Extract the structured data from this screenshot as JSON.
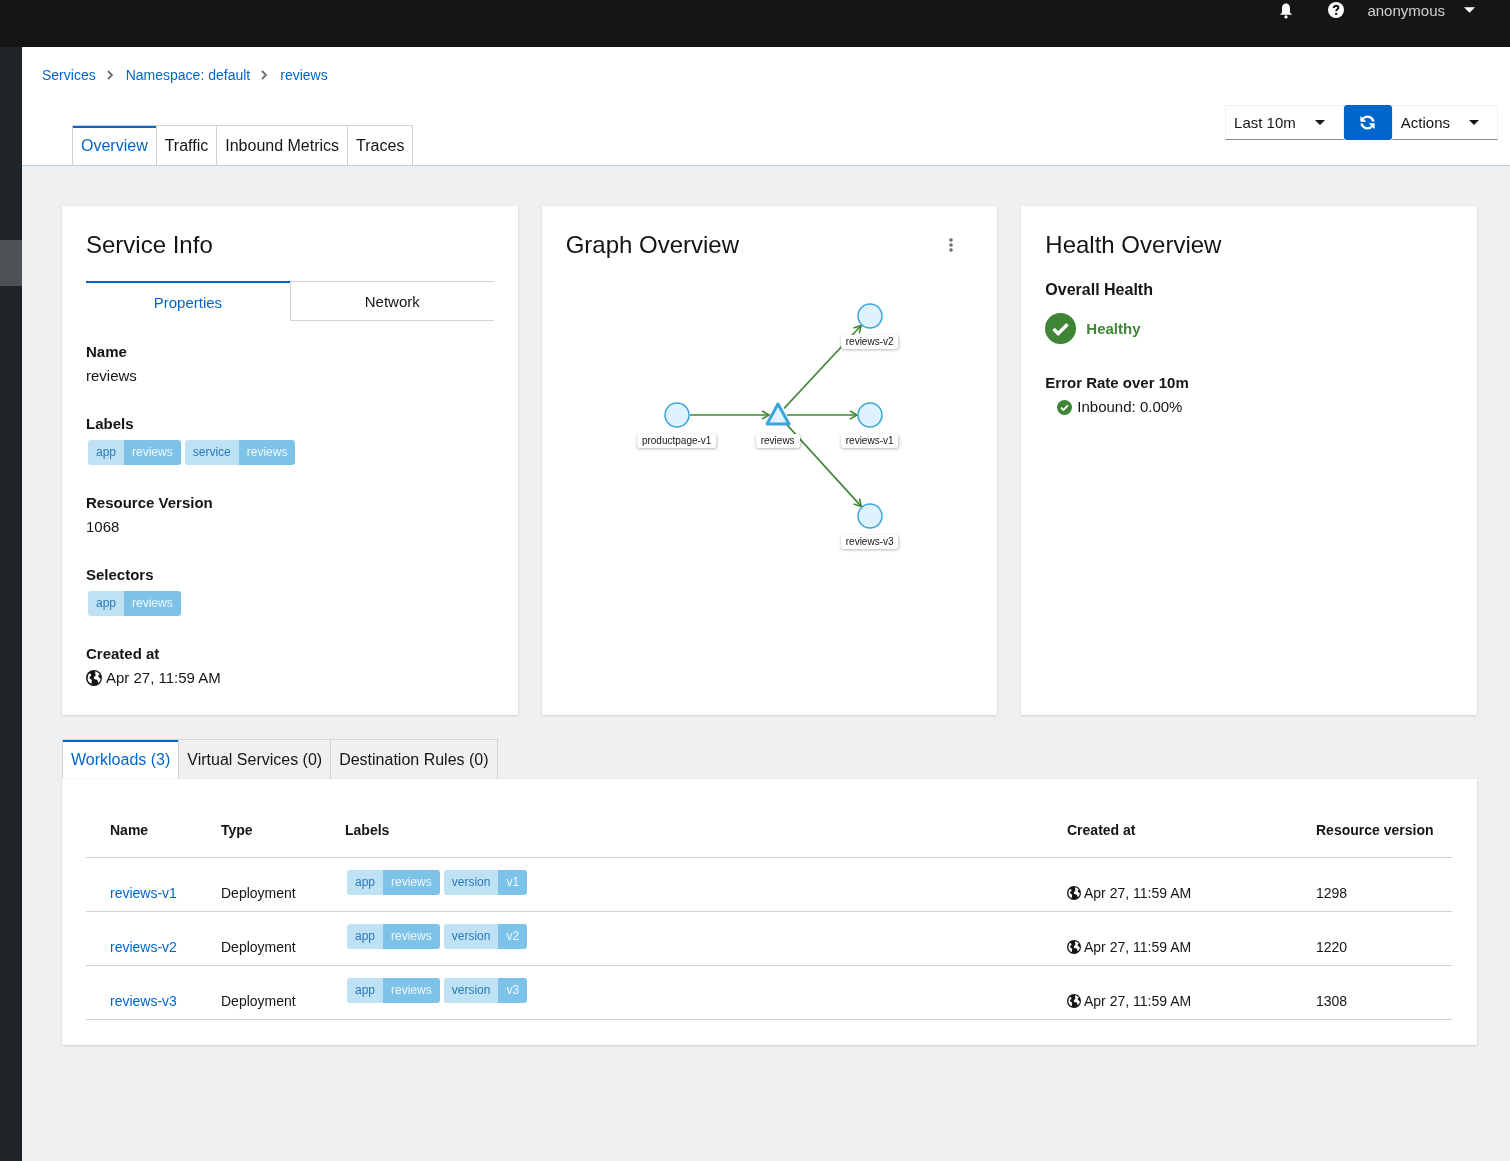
{
  "masthead": {
    "user": "anonymous"
  },
  "breadcrumbs": [
    {
      "label": "Services"
    },
    {
      "label": "Namespace: default"
    },
    {
      "label": "reviews"
    }
  ],
  "tabs": [
    {
      "label": "Overview",
      "selected": true
    },
    {
      "label": "Traffic",
      "selected": false
    },
    {
      "label": "Inbound Metrics",
      "selected": false
    },
    {
      "label": "Traces",
      "selected": false
    }
  ],
  "toolbar": {
    "interval": "Last 10m",
    "actions": "Actions"
  },
  "service_info": {
    "title": "Service Info",
    "tabs": [
      {
        "label": "Properties",
        "selected": true
      },
      {
        "label": "Network",
        "selected": false
      }
    ],
    "properties": [
      {
        "kind": "text",
        "label": "Name",
        "value": "reviews"
      },
      {
        "kind": "labels",
        "label": "Labels",
        "labels": [
          {
            "key": "app",
            "value": "reviews"
          },
          {
            "key": "service",
            "value": "reviews"
          }
        ]
      },
      {
        "kind": "text",
        "label": "Resource Version",
        "value": "1068"
      },
      {
        "kind": "labels",
        "label": "Selectors",
        "labels": [
          {
            "key": "app",
            "value": "reviews"
          }
        ]
      },
      {
        "kind": "time",
        "label": "Created at",
        "value": "Apr 27, 11:59 AM"
      }
    ]
  },
  "graph_overview": {
    "title": "Graph Overview",
    "nodes": [
      {
        "label": "productpage-v1",
        "kind": "workload"
      },
      {
        "label": "reviews",
        "kind": "service"
      },
      {
        "label": "reviews-v2",
        "kind": "workload"
      },
      {
        "label": "reviews-v1",
        "kind": "workload"
      },
      {
        "label": "reviews-v3",
        "kind": "workload"
      }
    ]
  },
  "health_overview": {
    "title": "Health Overview",
    "overall_label": "Overall Health",
    "overall": {
      "status": "Healthy",
      "kind": "healthy"
    },
    "error_rate_label": "Error Rate over 10m",
    "inbound": {
      "text": "Inbound: 0.00%",
      "kind": "healthy"
    }
  },
  "detail_tabs": [
    {
      "label": "Workloads (3)",
      "selected": true
    },
    {
      "label": "Virtual Services (0)",
      "selected": false
    },
    {
      "label": "Destination Rules (0)",
      "selected": false
    }
  ],
  "workloads": {
    "columns": [
      "Name",
      "Type",
      "Labels",
      "Created at",
      "Resource version"
    ],
    "rows": [
      {
        "name": "reviews-v1",
        "type": "Deployment",
        "labels": [
          {
            "key": "app",
            "value": "reviews"
          },
          {
            "key": "version",
            "value": "v1"
          }
        ],
        "created": "Apr 27, 11:59 AM",
        "resource_version": "1298"
      },
      {
        "name": "reviews-v2",
        "type": "Deployment",
        "labels": [
          {
            "key": "app",
            "value": "reviews"
          },
          {
            "key": "version",
            "value": "v2"
          }
        ],
        "created": "Apr 27, 11:59 AM",
        "resource_version": "1220"
      },
      {
        "name": "reviews-v3",
        "type": "Deployment",
        "labels": [
          {
            "key": "app",
            "value": "reviews"
          },
          {
            "key": "version",
            "value": "v3"
          }
        ],
        "created": "Apr 27, 11:59 AM",
        "resource_version": "1308"
      }
    ]
  }
}
